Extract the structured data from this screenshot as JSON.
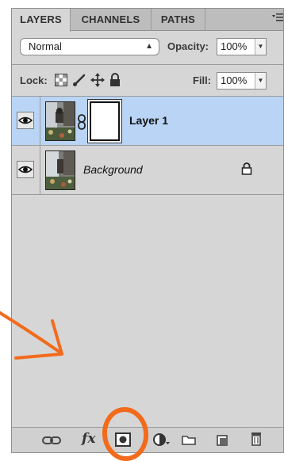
{
  "tabs": [
    {
      "label": "LAYERS",
      "active": true
    },
    {
      "label": "CHANNELS",
      "active": false
    },
    {
      "label": "PATHS",
      "active": false
    }
  ],
  "blend_mode": {
    "value": "Normal"
  },
  "opacity": {
    "label": "Opacity:",
    "value": "100%"
  },
  "lock": {
    "label": "Lock:"
  },
  "fill": {
    "label": "Fill:",
    "value": "100%"
  },
  "layers": [
    {
      "name": "Layer 1",
      "selected": true,
      "visible": true,
      "has_mask": true
    },
    {
      "name": "Background",
      "selected": false,
      "visible": true,
      "locked": true
    }
  ],
  "footer_icons": [
    "link-layers-icon",
    "fx-icon",
    "add-layer-mask-icon",
    "adjustment-layer-icon",
    "new-group-icon",
    "new-layer-icon",
    "delete-layer-icon"
  ],
  "footer_fx_text": "fx",
  "colors": {
    "selection": "#b9d4f4",
    "annotation": "#f26b1d"
  }
}
